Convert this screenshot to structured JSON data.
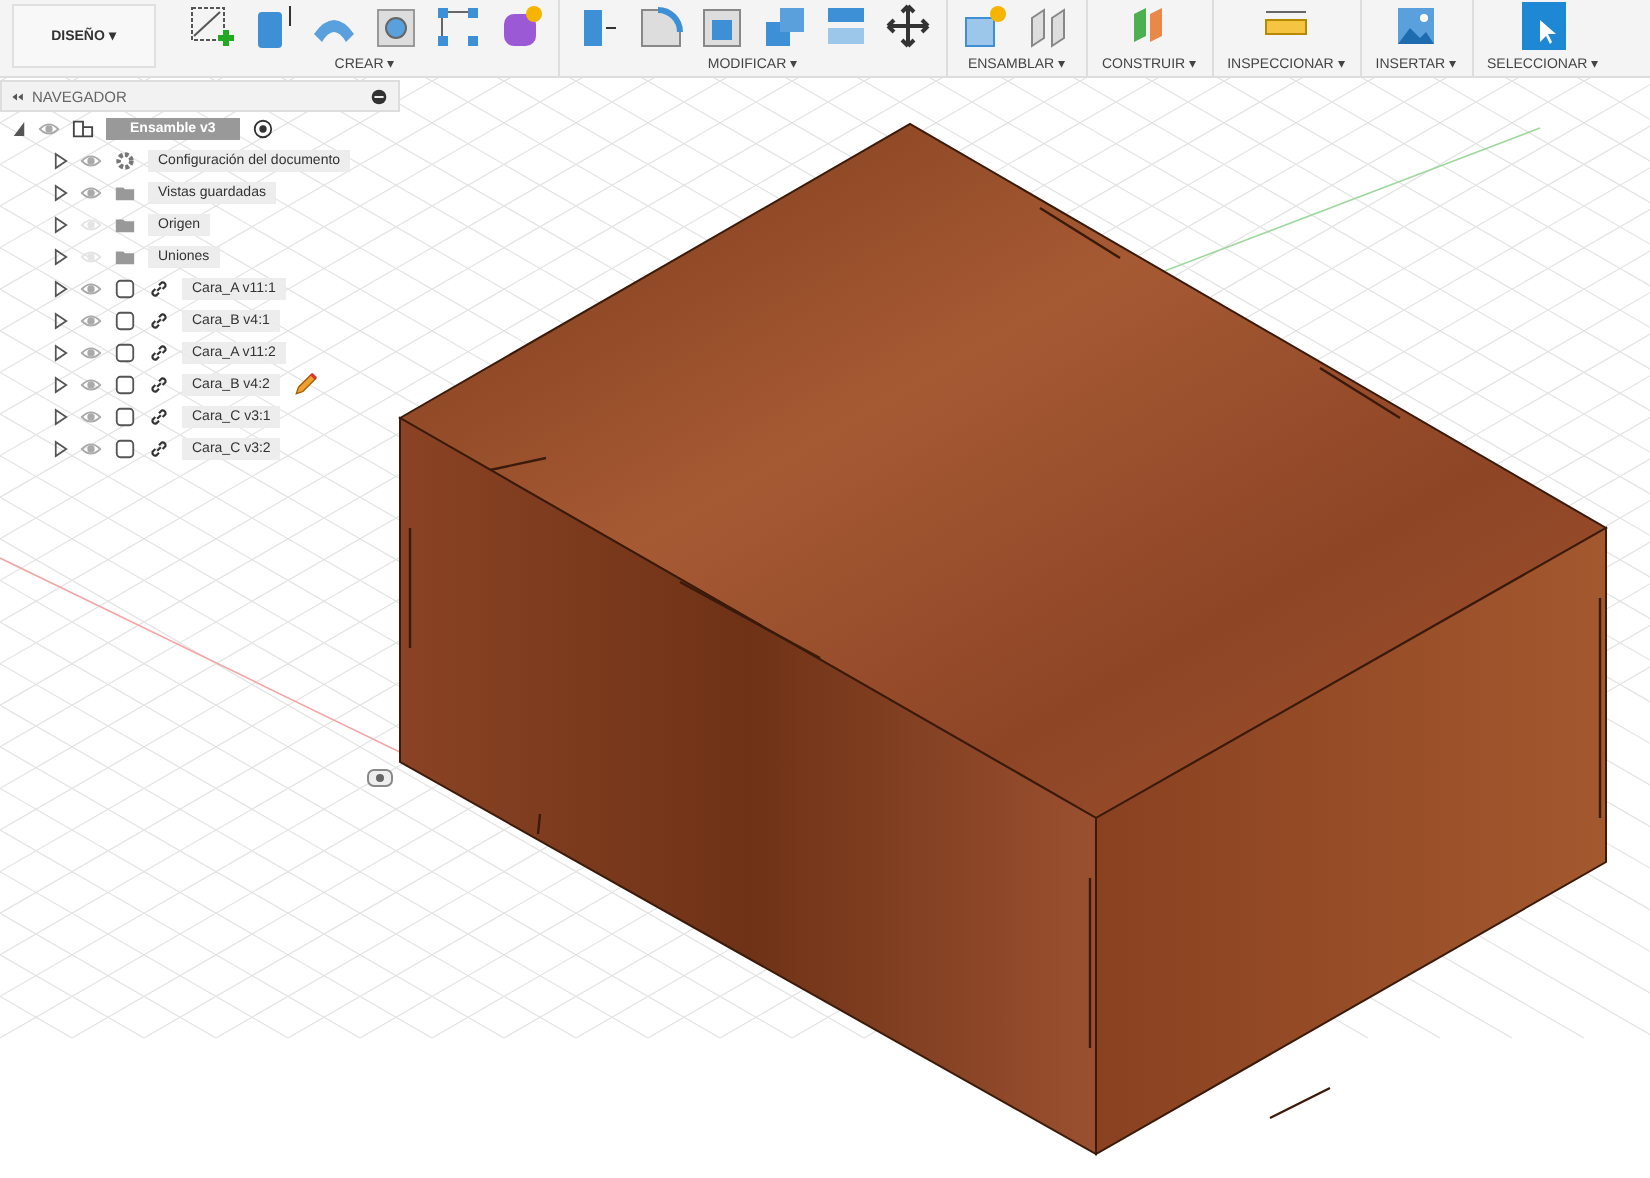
{
  "workspace_menu": {
    "label": "DISEÑO",
    "caret": "▾"
  },
  "toolbar_groups": [
    {
      "label": "CREAR ▾",
      "tools": [
        {
          "kind": "sketch"
        },
        {
          "kind": "extrude"
        },
        {
          "kind": "revolve"
        },
        {
          "kind": "hole"
        },
        {
          "kind": "pattern"
        },
        {
          "kind": "form"
        }
      ]
    },
    {
      "label": "MODIFICAR ▾",
      "tools": [
        {
          "kind": "presspull"
        },
        {
          "kind": "fillet"
        },
        {
          "kind": "shell"
        },
        {
          "kind": "combine"
        },
        {
          "kind": "split"
        },
        {
          "kind": "move"
        }
      ]
    },
    {
      "label": "ENSAMBLAR ▾",
      "tools": [
        {
          "kind": "component"
        },
        {
          "kind": "joint"
        }
      ]
    },
    {
      "label": "CONSTRUIR ▾",
      "tools": [
        {
          "kind": "plane"
        }
      ]
    },
    {
      "label": "INSPECCIONAR ▾",
      "tools": [
        {
          "kind": "measure"
        }
      ]
    },
    {
      "label": "INSERTAR ▾",
      "tools": [
        {
          "kind": "image"
        }
      ]
    },
    {
      "label": "SELECCIONAR ▾",
      "tools": [
        {
          "kind": "select"
        }
      ]
    }
  ],
  "navigator": {
    "title": "NAVEGADOR",
    "root": {
      "label": "Ensamble v3",
      "kind": "assembly",
      "visible": true,
      "selected": true,
      "expanded": true,
      "children": [
        {
          "label": "Configuración del documento",
          "kind": "settings",
          "visible": true,
          "active": false,
          "selected": false
        },
        {
          "label": "Vistas guardadas",
          "kind": "folder",
          "visible": true,
          "active": false,
          "selected": false
        },
        {
          "label": "Origen",
          "kind": "folder",
          "visible": false,
          "active": false,
          "selected": false
        },
        {
          "label": "Uniones",
          "kind": "folder",
          "visible": false,
          "active": false,
          "selected": false
        },
        {
          "label": "Cara_A v11:1",
          "kind": "component",
          "visible": true,
          "active": false,
          "selected": false
        },
        {
          "label": "Cara_B v4:1",
          "kind": "component",
          "visible": true,
          "active": false,
          "selected": false
        },
        {
          "label": "Cara_A v11:2",
          "kind": "component",
          "visible": true,
          "active": false,
          "selected": false
        },
        {
          "label": "Cara_B v4:2",
          "kind": "component",
          "visible": true,
          "active": true,
          "selected": false
        },
        {
          "label": "Cara_C v3:1",
          "kind": "component",
          "visible": true,
          "active": false,
          "selected": false
        },
        {
          "label": "Cara_C v3:2",
          "kind": "component",
          "visible": true,
          "active": false,
          "selected": false
        }
      ]
    }
  }
}
